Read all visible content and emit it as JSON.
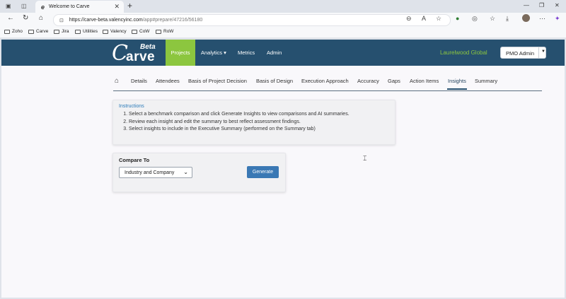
{
  "browser": {
    "tab_title": "Welcome to Carve",
    "tab_favicon": "e",
    "url_host": "https://carve-beta.valencyinc.com",
    "url_path": "/app#prepare/47216/56180",
    "bookmarks": [
      "Zoho",
      "Carve",
      "Jira",
      "Utilities",
      "Valency",
      "CoW",
      "RoW"
    ]
  },
  "app": {
    "logo_c": "C",
    "logo_rest": "arve",
    "logo_beta": "Beta",
    "nav": [
      "Projects",
      "Analytics ▾",
      "Metrics",
      "Admin"
    ],
    "org_name": "Laurelwood Global",
    "user_button": "PMO Admin",
    "colors": {
      "nav_bg": "#26506f",
      "accent_green": "#8cc63f",
      "button_blue": "#3a78b4"
    }
  },
  "subtabs": [
    "Details",
    "Attendees",
    "Basis of Project Decision",
    "Basis of Design",
    "Execution Approach",
    "Accuracy",
    "Gaps",
    "Action Items",
    "Insights",
    "Summary"
  ],
  "active_subtab": "Insights",
  "instructions": {
    "heading": "Instructions",
    "steps": [
      "Select a benchmark comparison and click Generate Insights to view comparisons and AI summaries.",
      "Review each insight and edit the summary to best reflect assessment findings.",
      "Select insights to include in the Executive Summary (performed on the Summary tab)"
    ]
  },
  "compare": {
    "label": "Compare To",
    "selected": "Industry and Company",
    "generate_label": "Generate"
  }
}
